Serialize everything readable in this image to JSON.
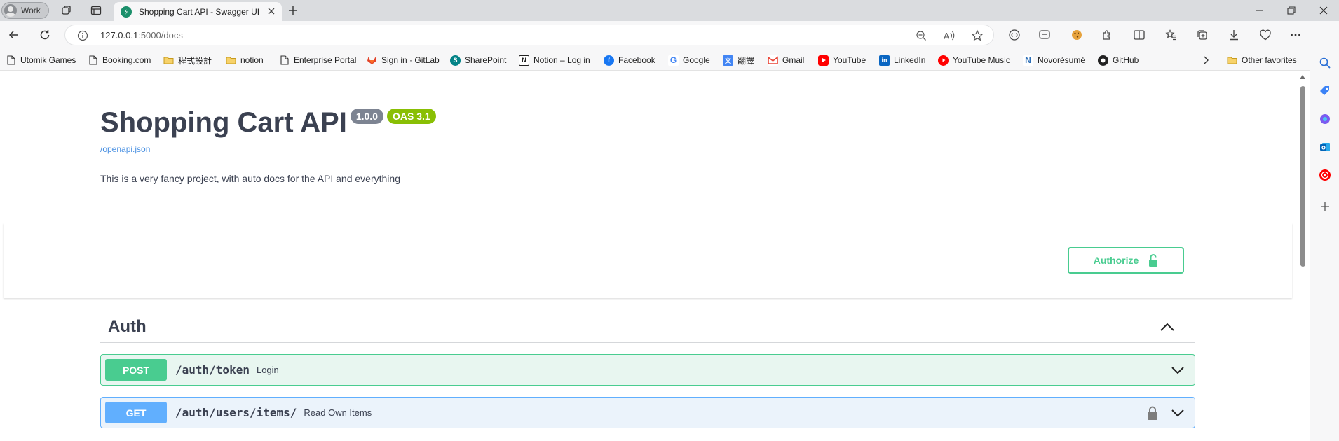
{
  "browser": {
    "profile_label": "Work",
    "tab_title": "Shopping Cart API - Swagger UI",
    "url_host": "127.0.0.1",
    "url_path": ":5000/docs",
    "favorites": [
      {
        "label": "Utomik Games",
        "icon": "page-icon"
      },
      {
        "label": "Booking.com",
        "icon": "page-icon"
      },
      {
        "label": "程式設計",
        "icon": "folder-icon"
      },
      {
        "label": "notion",
        "icon": "folder-icon"
      },
      {
        "label": "Enterprise Portal",
        "icon": "page-icon"
      },
      {
        "label": "Sign in · GitLab",
        "icon": "gitlab-icon"
      },
      {
        "label": "SharePoint",
        "icon": "sharepoint-icon"
      },
      {
        "label": "Notion – Log in",
        "icon": "notion-icon"
      },
      {
        "label": "Facebook",
        "icon": "facebook-icon"
      },
      {
        "label": "Google",
        "icon": "google-icon"
      },
      {
        "label": "翻譯",
        "icon": "translate-icon"
      },
      {
        "label": "Gmail",
        "icon": "gmail-icon"
      },
      {
        "label": "YouTube",
        "icon": "youtube-icon"
      },
      {
        "label": "LinkedIn",
        "icon": "linkedin-icon"
      },
      {
        "label": "YouTube Music",
        "icon": "youtube-music-icon"
      },
      {
        "label": "Novorésumé",
        "icon": "novoresume-icon"
      },
      {
        "label": "GitHub",
        "icon": "github-icon"
      }
    ],
    "other_favorites": "Other favorites"
  },
  "swagger": {
    "title": "Shopping Cart API",
    "version": "1.0.0",
    "oas": "OAS 3.1",
    "spec_link": "/openapi.json",
    "description": "This is a very fancy project, with auto docs for the API and everything",
    "authorize_label": "Authorize",
    "tag": {
      "name": "Auth",
      "operations": [
        {
          "method": "POST",
          "path": "/auth/token",
          "summary": "Login"
        },
        {
          "method": "GET",
          "path": "/auth/users/items/",
          "summary": "Read Own Items"
        }
      ]
    }
  },
  "colors": {
    "post": "#49cc90",
    "get": "#61affe",
    "text": "#3b4151",
    "link": "#4990e2",
    "oas_badge": "#89bf04",
    "version_badge": "#7d8492"
  }
}
